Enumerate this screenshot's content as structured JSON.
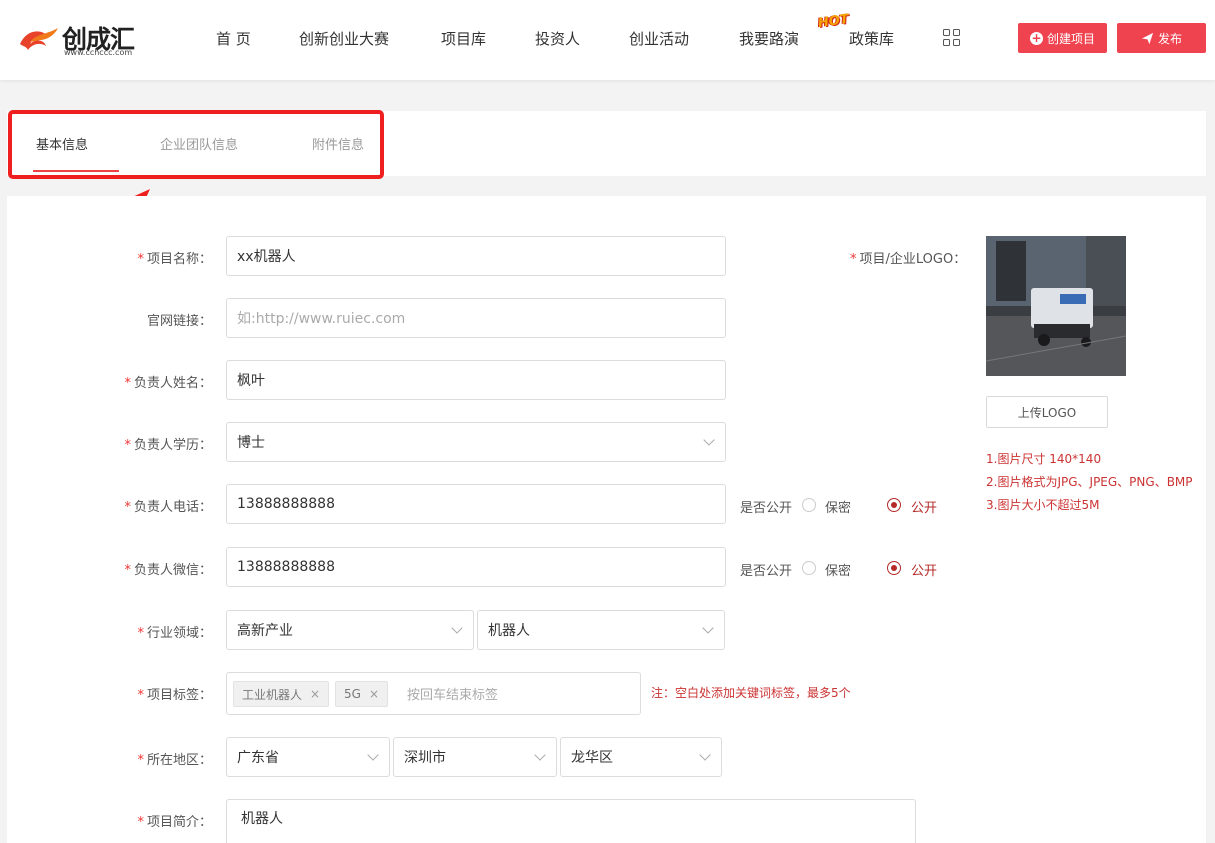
{
  "brand": {
    "name": "创成汇",
    "url": "www.cchccc.com"
  },
  "nav": {
    "items": [
      "首 页",
      "创新创业大赛",
      "项目库",
      "投资人",
      "创业活动",
      "我要路演",
      "政策库"
    ],
    "hot_badge": "HOT"
  },
  "header_buttons": {
    "create": "创建项目",
    "publish": "发布"
  },
  "tabs": [
    "基本信息",
    "企业团队信息",
    "附件信息"
  ],
  "form": {
    "project_name": {
      "label": "项目名称：",
      "value": "xx机器人"
    },
    "website": {
      "label": "官网链接：",
      "placeholder": "如:http://www.ruiec.com"
    },
    "owner_name": {
      "label": "负责人姓名：",
      "value": "枫叶"
    },
    "owner_edu": {
      "label": "负责人学历：",
      "value": "博士"
    },
    "owner_phone": {
      "label": "负责人电话：",
      "value": "13888888888"
    },
    "owner_wechat": {
      "label": "负责人微信：",
      "value": "13888888888"
    },
    "visibility": {
      "label": "是否公开",
      "private": "保密",
      "public": "公开"
    },
    "industry": {
      "label": "行业领域：",
      "primary": "高新产业",
      "secondary": "机器人"
    },
    "tags": {
      "label": "项目标签：",
      "items": [
        "工业机器人",
        "5G"
      ],
      "placeholder": "按回车结束标签",
      "note": "注：空白处添加关键词标签，最多5个"
    },
    "region": {
      "label": "所在地区：",
      "province": "广东省",
      "city": "深圳市",
      "district": "龙华区"
    },
    "intro": {
      "label": "项目简介：",
      "value": "机器人"
    }
  },
  "logo_panel": {
    "label": "项目/企业LOGO：",
    "upload": "上传LOGO",
    "notes": [
      "1.图片尺寸 140*140",
      "2.图片格式为JPG、JPEG、PNG、BMP",
      "3.图片大小不超过5M"
    ]
  },
  "colors": {
    "accent": "#ef4350",
    "annotation": "#f01f1f",
    "radio": "#b52a2a"
  },
  "required_mark": "*",
  "tag_remove": "×"
}
